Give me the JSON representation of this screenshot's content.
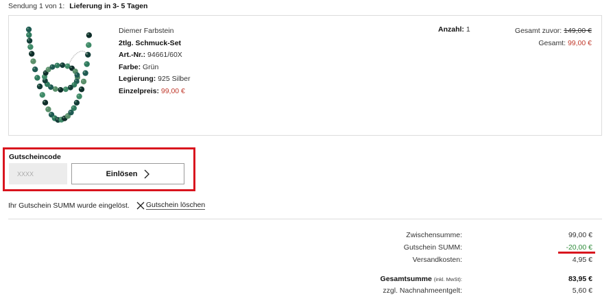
{
  "shipment": {
    "label": "Sendung 1 von 1:",
    "delivery": "Lieferung in 3- 5 Tagen"
  },
  "product": {
    "brand": "Diemer Farbstein",
    "name": "2tlg. Schmuck-Set",
    "article_label": "Art.-Nr.:",
    "article_value": "94661/60X",
    "color_label": "Farbe:",
    "color_value": "Grün",
    "alloy_label": "Legierung:",
    "alloy_value": "925 Silber",
    "unit_price_label": "Einzelpreis:",
    "unit_price_value": "99,00 €",
    "quantity_label": "Anzahl:",
    "quantity_value": "1",
    "total_before_label": "Gesamt zuvor:",
    "total_before_value": "149,00 €",
    "total_label": "Gesamt:",
    "total_value": "99,00 €",
    "image_icon": "bead-necklace-bracelet-image"
  },
  "voucher": {
    "title": "Gutscheincode",
    "placeholder": "XXXX",
    "redeem_label": "Einlösen",
    "message": "Ihr Gutschein SUMM wurde eingelöst.",
    "delete_label": "Gutschein löschen"
  },
  "summary": {
    "subtotal_label": "Zwischensumme:",
    "subtotal_value": "99,00 €",
    "voucher_label": "Gutschein SUMM:",
    "voucher_value": "-20,00 €",
    "shipping_label": "Versandkosten:",
    "shipping_value": "4,95 €",
    "total_label": "Gesamtsumme",
    "total_note": "(inkl. MwSt):",
    "total_value": "83,95 €",
    "cod_label": "zzgl. Nachnahmeentgelt:",
    "cod_value": "5,60 €"
  },
  "colors": {
    "accent_red": "#d9141e",
    "price_red": "#c0392b",
    "discount_green": "#2e8b3a"
  }
}
